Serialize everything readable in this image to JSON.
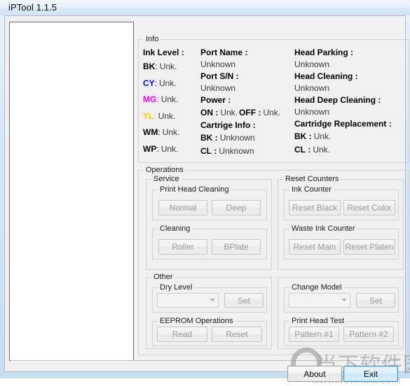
{
  "window": {
    "title": "iPTool 1.1.5"
  },
  "info": {
    "legend": "Info",
    "col1": {
      "heading": "Ink Level :",
      "rows": [
        {
          "key": "BK",
          "sep": ":",
          "value": "Unk.",
          "color": "#000000"
        },
        {
          "key": "CY",
          "sep": ":",
          "value": "Unk.",
          "color": "#0000ff"
        },
        {
          "key": "MG",
          "sep": ":",
          "value": "Unk.",
          "color": "#ff00ff"
        },
        {
          "key": "YL",
          "sep": ":",
          "value": "Unk.",
          "color": "#ffd000"
        },
        {
          "key": "WM",
          "sep": ":",
          "value": "Unk.",
          "color": "#000000"
        },
        {
          "key": "WP",
          "sep": ":",
          "value": "Unk.",
          "color": "#000000"
        }
      ]
    },
    "col2": {
      "port_name_label": "Port Name :",
      "port_name_value": "Unknown",
      "port_sn_label": "Port S/N :",
      "port_sn_value": "Unknown",
      "power_label": "Power :",
      "power_on_key": "ON",
      "power_on_value": "Unk.",
      "power_off_key": "OFF",
      "power_off_value": "Unk.",
      "cartridge_info_label": "Cartrige Info :",
      "cartridge_bk_key": "BK",
      "cartridge_bk_value": "Unknown",
      "cartridge_cl_key": "CL",
      "cartridge_cl_value": "Unknown"
    },
    "col3": {
      "head_parking_label": "Head Parking :",
      "head_parking_value": "Unknown",
      "head_cleaning_label": "Head Cleaning :",
      "head_cleaning_value": "Unknown",
      "head_deep_cleaning_label": "Head Deep Cleaning :",
      "head_deep_cleaning_value": "Unknown",
      "cartridge_replacement_label": "Cartridge Replacement :",
      "repl_bk_key": "BK",
      "repl_bk_value": "Unk.",
      "repl_cl_key": "CL",
      "repl_cl_value": "Unk."
    }
  },
  "operations": {
    "legend": "Operations",
    "service": {
      "legend": "Service",
      "print_head_cleaning": {
        "legend": "Print Head Cleaning",
        "normal_label": "Normal",
        "deep_label": "Deep"
      },
      "cleaning": {
        "legend": "Cleaning",
        "roller_label": "Roller",
        "bplate_label": "BPlate"
      }
    },
    "reset_counters": {
      "legend": "Reset Counters",
      "ink_counter": {
        "legend": "Ink Counter",
        "reset_black_label": "Reset Black",
        "reset_color_label": "Reset Color"
      },
      "waste_ink_counter": {
        "legend": "Waste Ink Counter",
        "reset_main_label": "Reset Main",
        "reset_platen_label": "Reset Platen"
      }
    },
    "other": {
      "legend": "Other",
      "dry_level": {
        "legend": "Dry Level",
        "selected": "",
        "set_label": "Set"
      },
      "eeprom": {
        "legend": "EEPROM Operations",
        "read_label": "Read",
        "reset_label": "Reset"
      }
    },
    "change_model": {
      "legend": "Change Model",
      "model_select": {
        "legend": "Change Model",
        "selected": "",
        "set_label": "Set"
      },
      "print_head_test": {
        "legend": "Print Head Test",
        "pattern1_label": "Pattern #1",
        "pattern2_label": "Pattern #2"
      }
    }
  },
  "footer": {
    "about_label": "About",
    "exit_label": "Exit"
  },
  "watermark": {
    "chinese": "当下软件园",
    "url": "www.downxia.com"
  }
}
